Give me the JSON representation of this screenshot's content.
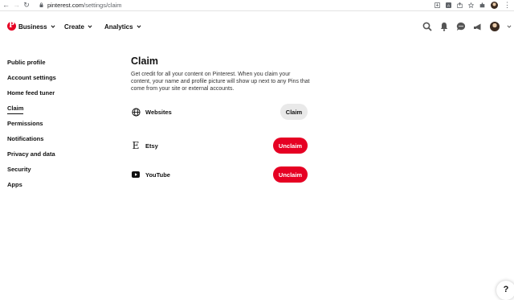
{
  "browser": {
    "url_domain": "pinterest.com",
    "url_path": "/settings/claim",
    "back_glyph": "←",
    "forward_glyph": "→",
    "reload_glyph": "↻",
    "menu_glyph": "⋮"
  },
  "header": {
    "logo": "P",
    "menus": [
      "Business",
      "Create",
      "Analytics"
    ],
    "icons": [
      "search-icon",
      "notifications-icon",
      "messages-icon",
      "updates-icon",
      "avatar",
      "account-chevron-icon"
    ]
  },
  "sidebar": {
    "items": [
      {
        "label": "Public profile"
      },
      {
        "label": "Account settings"
      },
      {
        "label": "Home feed tuner"
      },
      {
        "label": "Claim"
      },
      {
        "label": "Permissions"
      },
      {
        "label": "Notifications"
      },
      {
        "label": "Privacy and data"
      },
      {
        "label": "Security"
      },
      {
        "label": "Apps"
      }
    ],
    "active": "Claim"
  },
  "main": {
    "title": "Claim",
    "description": "Get credit for all your content on Pinterest. When you claim your content, your name and profile picture will show up next to any Pins that come from your site or external accounts.",
    "accounts": [
      {
        "label": "Websites",
        "icon": "globe-icon",
        "button": "Claim"
      },
      {
        "label": "Etsy",
        "icon": "etsy-icon",
        "glyph": "E",
        "button": "Unclaim"
      },
      {
        "label": "YouTube",
        "icon": "youtube-icon",
        "button": "Unclaim"
      }
    ]
  },
  "help": {
    "label": "?"
  },
  "colors": {
    "brand": "#e60023",
    "claim_bg": "#e9e9e9"
  }
}
